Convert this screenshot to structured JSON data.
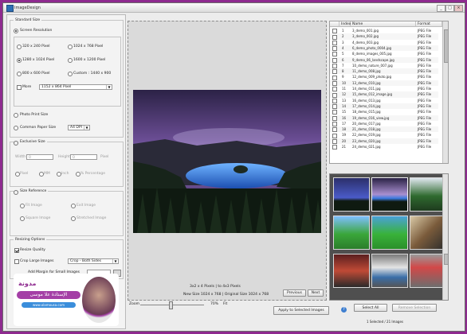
{
  "window": {
    "title": "ImageDesign",
    "minimize": "_",
    "maximize": "□",
    "close": "×"
  },
  "standard_size": {
    "group_title": "Standard Size",
    "screen_resolution_label": "Screen Resolution",
    "resolutions": [
      "320 x 240 Pixel",
      "1024 x 768 Pixel",
      "1280 x 1024 Pixel",
      "1600 x 1200 Pixel",
      "800 x 600 Pixel",
      "Custom : 1440 x 900"
    ],
    "more_label": "More",
    "more_value": "1152 x 864 Pixel",
    "photo_print_label": "Photo Print Size",
    "common_paper_label": "Common Paper Size",
    "common_paper_value": "A4 DPI"
  },
  "exclusive_size": {
    "group_title": "Exclusive Size",
    "width_label": "Width",
    "width_value": "0",
    "height_label": "Height",
    "height_value": "0",
    "unit_label": "Pixel",
    "units": [
      "Pixel",
      "MM",
      "Inch",
      "% Percentage"
    ]
  },
  "size_reference": {
    "group_title": "Size Reference",
    "options": [
      "Fit Image",
      "Exit Image",
      "Square Image",
      "Stretched Image"
    ]
  },
  "resizing_options": {
    "group_title": "Resizing Options",
    "resize_quality_label": "Resize Quality",
    "crop_large_label": "Crop Large Images",
    "crop_large_value": "Crop - Both Sides",
    "add_margin_label": "Add Margin for Small Images"
  },
  "watermark": {
    "line1": "مدونة",
    "line2": "الإستاذة علا موسى",
    "line3": "www.olamousa.com"
  },
  "preview": {
    "info_line1": "3x2 x 4 Pixels | to 4x3 Pixels",
    "info_line2": "New Size 1024 x 768 | Original Size 1024 x 768",
    "previous_button": "Previous",
    "next_button": "Next",
    "zoom_label": "Zoom",
    "zoom_value": "70%",
    "zoom_fraction": 0.47,
    "fit_label": "Fit",
    "apply_button": "Apply to Selected Images"
  },
  "file_table": {
    "columns": [
      "Index",
      "Name",
      "Format"
    ],
    "rows": [
      {
        "index": "1",
        "name": "3_demo_001.jpg",
        "format": "JPEG File",
        "checked": true
      },
      {
        "index": "2",
        "name": "3_demo_002.jpg",
        "format": "JPEG File",
        "checked": true
      },
      {
        "index": "3",
        "name": "4_demo_003.jpg",
        "format": "JPEG File",
        "checked": true
      },
      {
        "index": "4",
        "name": "6_demo_photo_0004.jpg",
        "format": "JPEG File",
        "checked": true
      },
      {
        "index": "5",
        "name": "8_demo_images_005.jpg",
        "format": "JPEG File",
        "checked": true
      },
      {
        "index": "6",
        "name": "9_demo_06_landscape.jpg",
        "format": "JPEG File",
        "checked": true
      },
      {
        "index": "7",
        "name": "10_demo_nature_007.jpg",
        "format": "JPEG File",
        "checked": true
      },
      {
        "index": "8",
        "name": "11_demo_008.jpg",
        "format": "JPEG File",
        "checked": true
      },
      {
        "index": "9",
        "name": "12_demo_009_photo.jpg",
        "format": "JPEG File",
        "checked": true
      },
      {
        "index": "10",
        "name": "13_demo_010.jpg",
        "format": "JPEG File",
        "checked": true
      },
      {
        "index": "11",
        "name": "14_demo_011.jpg",
        "format": "JPEG File",
        "checked": true
      },
      {
        "index": "12",
        "name": "15_demo_012_image.jpg",
        "format": "JPEG File",
        "checked": true
      },
      {
        "index": "13",
        "name": "16_demo_013.jpg",
        "format": "JPEG File",
        "checked": true
      },
      {
        "index": "14",
        "name": "17_demo_014.jpg",
        "format": "JPEG File",
        "checked": true
      },
      {
        "index": "15",
        "name": "18_demo_015.jpg",
        "format": "JPEG File",
        "checked": true
      },
      {
        "index": "16",
        "name": "19_demo_016_view.jpg",
        "format": "JPEG File",
        "checked": true
      },
      {
        "index": "17",
        "name": "20_demo_017.jpg",
        "format": "JPEG File",
        "checked": true
      },
      {
        "index": "18",
        "name": "21_demo_018.jpg",
        "format": "JPEG File",
        "checked": true
      },
      {
        "index": "19",
        "name": "22_demo_019.jpg",
        "format": "JPEG File",
        "checked": true
      },
      {
        "index": "20",
        "name": "23_demo_020.jpg",
        "format": "JPEG File",
        "checked": true
      },
      {
        "index": "21",
        "name": "24_demo_021.jpg",
        "format": "JPEG File",
        "checked": true
      }
    ]
  },
  "selection": {
    "select_all_button": "Select All",
    "remove_button": "Remove Selection",
    "status_text": "1 Selected / 21 Images"
  },
  "colors": {
    "accent": "#8e2a8f",
    "thumb_bg": "#4f4f4f"
  }
}
